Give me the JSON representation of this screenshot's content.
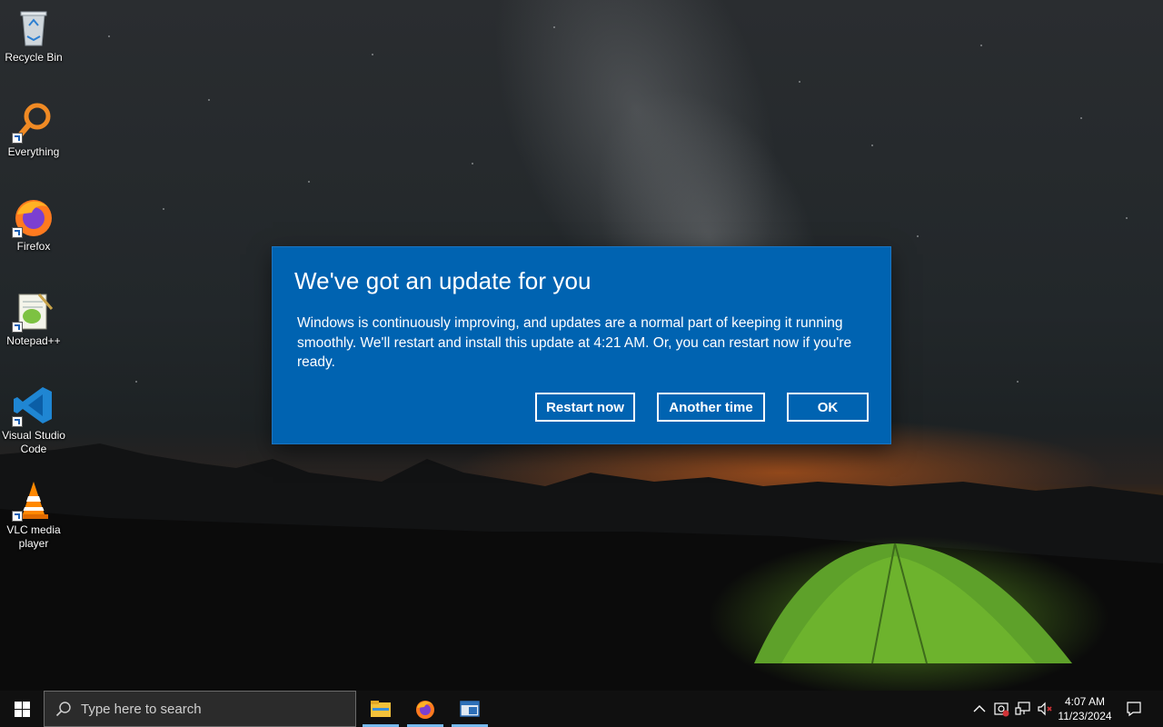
{
  "desktop": {
    "icons": [
      {
        "label": "Recycle Bin",
        "icon": "recycle-bin-icon"
      },
      {
        "label": "Everything",
        "icon": "everything-search-icon"
      },
      {
        "label": "Firefox",
        "icon": "firefox-icon"
      },
      {
        "label": "Notepad++",
        "icon": "notepad-plus-plus-icon"
      },
      {
        "label": "Visual Studio Code",
        "icon": "vscode-icon"
      },
      {
        "label": "VLC media player",
        "icon": "vlc-icon"
      }
    ]
  },
  "dialog": {
    "title": "We've got an update for you",
    "body": "Windows is continuously improving, and updates are a normal part of keeping it running smoothly. We'll restart and install this update at 4:21 AM. Or, you can restart now if you're ready.",
    "buttons": {
      "restart": "Restart now",
      "another": "Another time",
      "ok": "OK"
    },
    "background_color": "#0063b1"
  },
  "taskbar": {
    "search_placeholder": "Type here to search",
    "pinned_apps": [
      "file-explorer-icon",
      "firefox-icon",
      "window-app-icon"
    ],
    "clock": {
      "time": "4:07 AM",
      "date": "11/23/2024"
    },
    "tray_icons": [
      "chevron-up-icon",
      "security-icon",
      "network-icon",
      "volume-muted-icon"
    ]
  },
  "colors": {
    "accent": "#0063b1",
    "taskbar": "#101010",
    "active_underline": "#76b9ed"
  }
}
